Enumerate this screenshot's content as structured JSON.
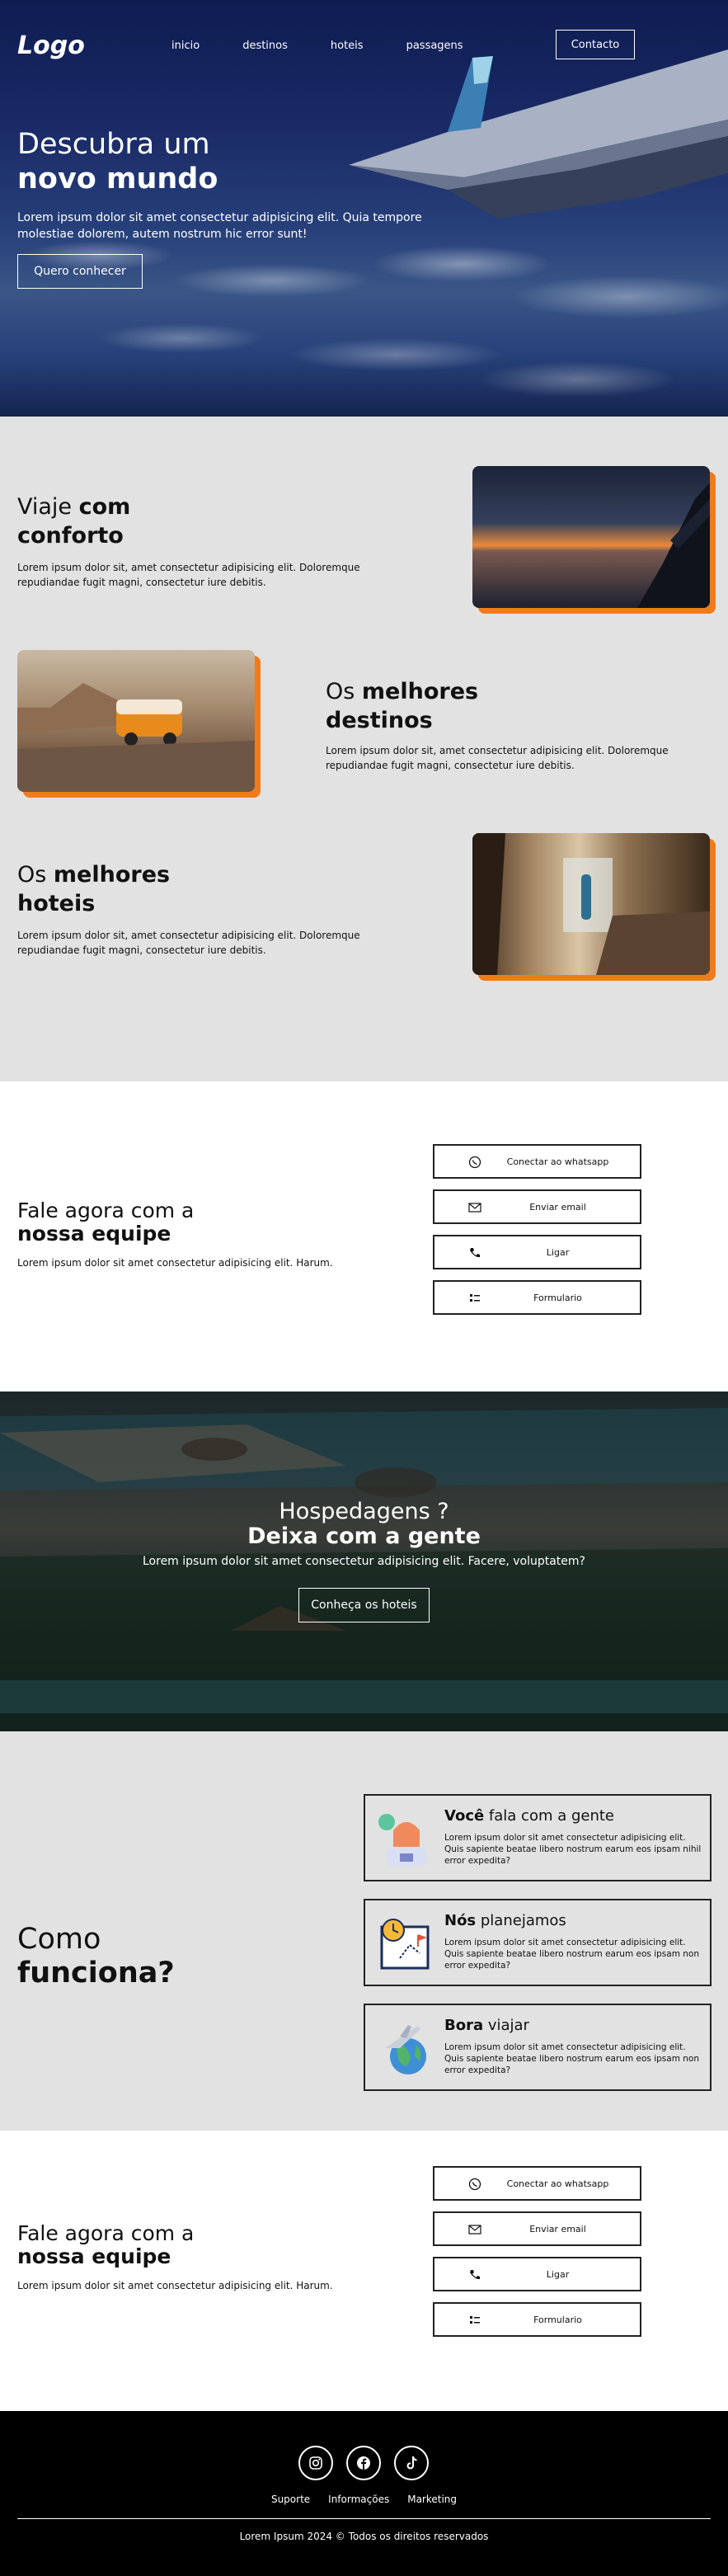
{
  "header": {
    "logo": "Logo",
    "nav": [
      "inicio",
      "destinos",
      "hoteis",
      "passagens"
    ],
    "contact_label": "Contacto"
  },
  "hero": {
    "title_line1": "Descubra um",
    "title_line2": "novo mundo",
    "text": "Lorem ipsum dolor sit amet consectetur adipisicing elit. Quia tempore molestiae dolorem, autem nostrum hic error sunt!",
    "button": "Quero conhecer"
  },
  "features": [
    {
      "title_light": "Viaje ",
      "title_bold": "com conforto",
      "text": "Lorem ipsum dolor sit, amet consectetur adipisicing elit. Doloremque repudiandae fugit magni, consectetur iure debitis."
    },
    {
      "title_light": "Os ",
      "title_bold": "melhores destinos",
      "text": "Lorem ipsum dolor sit, amet consectetur adipisicing elit. Doloremque repudiandae fugit magni, consectetur iure debitis."
    },
    {
      "title_light": "Os ",
      "title_bold": "melhores hoteis",
      "text": "Lorem ipsum dolor sit, amet consectetur adipisicing elit. Doloremque repudiandae fugit magni, consectetur iure debitis."
    }
  ],
  "contact": {
    "title_line1": "Fale agora com a",
    "title_line2": "nossa equipe",
    "text": "Lorem ipsum dolor sit amet consectetur adipisicing elit. Harum.",
    "buttons": [
      {
        "label": "Conectar ao whatsapp",
        "icon": "whatsapp-icon"
      },
      {
        "label": "Enviar email",
        "icon": "mail-icon"
      },
      {
        "label": "Ligar",
        "icon": "phone-icon"
      },
      {
        "label": "Formulario",
        "icon": "list-icon"
      }
    ]
  },
  "hotels": {
    "title_line1": "Hospedagens ?",
    "title_line2": "Deixa com a gente",
    "text": "Lorem ipsum dolor sit amet consectetur adipisicing elit. Facere, voluptatem?",
    "button": "Conheça os hoteis"
  },
  "how": {
    "title_line1": "Como",
    "title_line2": "funciona?",
    "cards": [
      {
        "title_bold": "Você",
        "title_light": " fala com a gente",
        "text": "Lorem ipsum dolor sit amet consectetur adipisicing elit. Quis sapiente beatae libero nostrum earum eos ipsam nihil error expedita?"
      },
      {
        "title_bold": "Nós",
        "title_light": " planejamos",
        "text": "Lorem ipsum dolor sit amet consectetur adipisicing elit. Quis sapiente beatae libero nostrum earum eos ipsam non error expedita?"
      },
      {
        "title_bold": "Bora",
        "title_light": " viajar",
        "text": "Lorem ipsum dolor sit amet consectetur adipisicing elit. Quis sapiente beatae libero nostrum earum eos ipsam non error expedita?"
      }
    ]
  },
  "footer": {
    "links": [
      "Suporte",
      "Informações",
      "Marketing"
    ],
    "copyright": "Lorem Ipsum 2024 © Todos os direitos reservados",
    "social_icons": [
      "instagram-icon",
      "facebook-icon",
      "tiktok-icon"
    ]
  },
  "colors": {
    "accent": "#f07b1a",
    "hero_bg": "#1a2a66",
    "section_gray": "#e2e2e2",
    "footer_bg": "#000000"
  }
}
